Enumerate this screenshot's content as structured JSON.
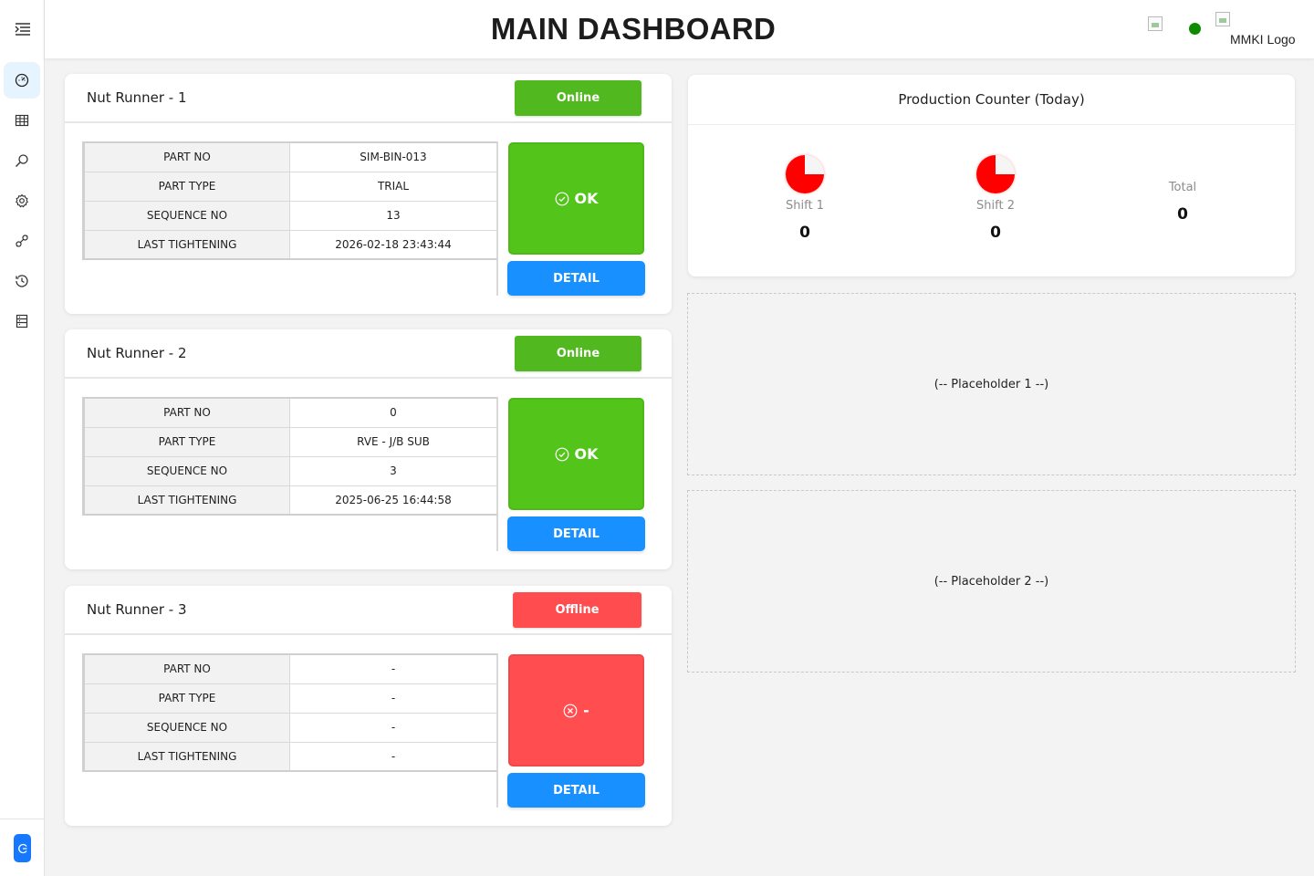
{
  "header": {
    "title": "MAIN DASHBOARD",
    "logo_alt": "MMKI Logo",
    "status_color": "#108a00"
  },
  "sidebar": {
    "items": [
      {
        "icon": "dashboard-gauge-icon",
        "active": true
      },
      {
        "icon": "table-icon",
        "active": false
      },
      {
        "icon": "search-analysis-icon",
        "active": false
      },
      {
        "icon": "settings-gear-icon",
        "active": false
      },
      {
        "icon": "api-link-icon",
        "active": false
      },
      {
        "icon": "history-clock-icon",
        "active": false
      },
      {
        "icon": "database-icon",
        "active": false
      }
    ]
  },
  "nut_runners": [
    {
      "title": "Nut Runner - 1",
      "status": "Online",
      "rows": [
        {
          "label": "PART NO",
          "value": "SIM-BIN-013"
        },
        {
          "label": "PART TYPE",
          "value": "TRIAL"
        },
        {
          "label": "SEQUENCE NO",
          "value": "13"
        },
        {
          "label": "LAST TIGHTENING",
          "value": "2026-02-18 23:43:44"
        }
      ],
      "result": "OK",
      "detail_label": "DETAIL"
    },
    {
      "title": "Nut Runner - 2",
      "status": "Online",
      "rows": [
        {
          "label": "PART NO",
          "value": "0"
        },
        {
          "label": "PART TYPE",
          "value": "RVE - J/B SUB"
        },
        {
          "label": "SEQUENCE NO",
          "value": "3"
        },
        {
          "label": "LAST TIGHTENING",
          "value": "2025-06-25 16:44:58"
        }
      ],
      "result": "OK",
      "detail_label": "DETAIL"
    },
    {
      "title": "Nut Runner - 3",
      "status": "Offline",
      "rows": [
        {
          "label": "PART NO",
          "value": "-"
        },
        {
          "label": "PART TYPE",
          "value": "-"
        },
        {
          "label": "SEQUENCE NO",
          "value": "-"
        },
        {
          "label": "LAST TIGHTENING",
          "value": "-"
        }
      ],
      "result": "-",
      "detail_label": "DETAIL"
    }
  ],
  "production": {
    "title": "Production Counter (Today)",
    "shift1": {
      "label": "Shift 1",
      "value": "0"
    },
    "shift2": {
      "label": "Shift 2",
      "value": "0"
    },
    "total": {
      "label": "Total",
      "value": "0"
    }
  },
  "placeholders": [
    "(-- Placeholder 1 --)",
    "(-- Placeholder 2 --)"
  ],
  "colors": {
    "online": "#52b820",
    "offline": "#ff4d4f",
    "ok": "#52c41a",
    "ng": "#ff4d50",
    "detail": "#1890ff",
    "accent": "#1677ff"
  }
}
